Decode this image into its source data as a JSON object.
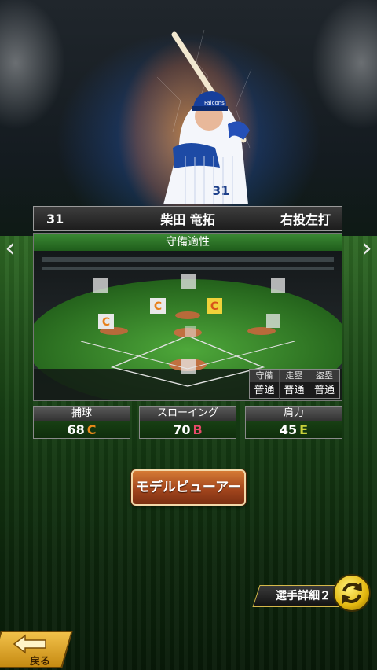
{
  "player": {
    "number": "31",
    "name": "柴田 竜拓",
    "handedness": "右投左打",
    "cap_text": "Falcons",
    "jersey_number": "31"
  },
  "panel": {
    "title": "守備適性",
    "positions": [
      {
        "position": "pitcher",
        "grade": ""
      },
      {
        "position": "catcher",
        "grade": ""
      },
      {
        "position": "first-base",
        "grade": ""
      },
      {
        "position": "second-base",
        "grade": "C",
        "color": "#e8801a"
      },
      {
        "position": "shortstop",
        "grade": "C",
        "color": "#e8801a"
      },
      {
        "position": "third-base",
        "grade": "C",
        "color": "#e8801a"
      },
      {
        "position": "left-field",
        "grade": ""
      },
      {
        "position": "center-field",
        "grade": ""
      },
      {
        "position": "right-field",
        "grade": ""
      }
    ],
    "mini_stats": {
      "headers": [
        "守備",
        "走塁",
        "盗塁"
      ],
      "values": [
        "普通",
        "普通",
        "普通"
      ]
    }
  },
  "stats": [
    {
      "label": "捕球",
      "value": "68",
      "grade": "C",
      "grade_color": "#e88a1a"
    },
    {
      "label": "スローイング",
      "value": "70",
      "grade": "B",
      "grade_color": "#e84a6a"
    },
    {
      "label": "肩力",
      "value": "45",
      "grade": "E",
      "grade_color": "#c8d23a"
    }
  ],
  "buttons": {
    "model_viewer": "モデルビューアー",
    "detail": "選手詳細２",
    "back": "戻る"
  },
  "nav": {
    "prev": "‹",
    "next": "›"
  }
}
